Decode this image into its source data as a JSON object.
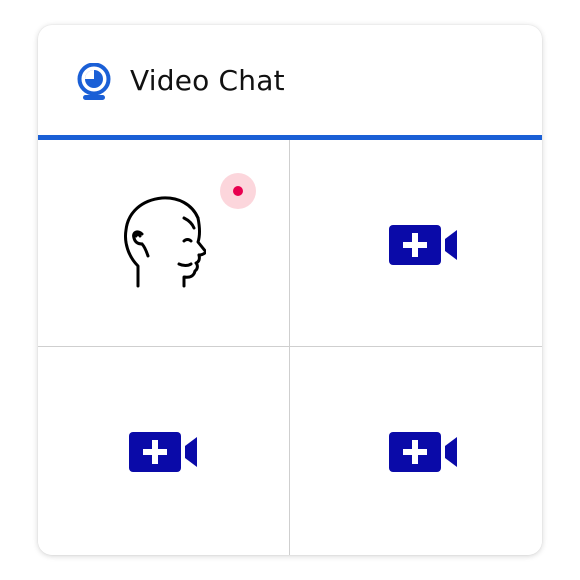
{
  "header": {
    "title": "Video Chat",
    "icon": "webcam-icon"
  },
  "colors": {
    "accent": "#1a5fd6",
    "camera_blue": "#0a0aa8",
    "status_red": "#e8004f",
    "status_halo": "#fcd6dc"
  },
  "participant": {
    "icon": "person-head-icon",
    "status": "recording-indicator"
  },
  "empty_slots": [
    {
      "icon": "add-video-icon"
    },
    {
      "icon": "add-video-icon"
    },
    {
      "icon": "add-video-icon"
    }
  ]
}
